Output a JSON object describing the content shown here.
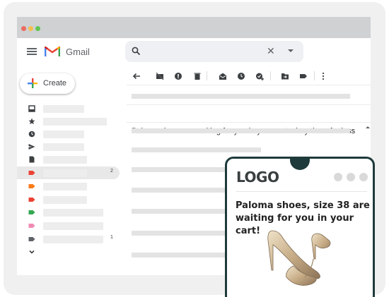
{
  "app": {
    "name": "Gmail"
  },
  "search": {
    "placeholder": ""
  },
  "compose": {
    "label": "Create"
  },
  "sidebar": {
    "items": [
      {
        "icon": "inbox-icon",
        "count": ""
      },
      {
        "icon": "star-icon",
        "count": ""
      },
      {
        "icon": "clock-icon",
        "count": ""
      },
      {
        "icon": "send-icon",
        "count": ""
      },
      {
        "icon": "document-icon",
        "count": ""
      },
      {
        "icon": "label-icon",
        "count": "2",
        "active": true,
        "color": "#ea4335"
      },
      {
        "icon": "label-icon",
        "count": "",
        "color": "#fa7b17"
      },
      {
        "icon": "label-icon",
        "count": "",
        "color": "#ea4335"
      },
      {
        "icon": "label-icon",
        "count": "",
        "color": "#34a853"
      },
      {
        "icon": "label-icon",
        "count": "",
        "color": "#f28bb3"
      },
      {
        "icon": "label-icon",
        "count": "1",
        "color": "#5f6368"
      },
      {
        "icon": "chevron-down-icon",
        "count": ""
      }
    ]
  },
  "toolbar": {
    "icons": [
      "back-arrow-icon",
      "archive-icon",
      "report-spam-icon",
      "delete-icon",
      "mark-unread-icon",
      "snooze-icon",
      "add-task-icon",
      "move-to-icon",
      "labels-icon",
      "more-icon"
    ]
  },
  "email": {
    "subject": "Paloma shoes are waiting for you in your cart – buy them for less"
  },
  "ad": {
    "logo": "LOGO",
    "title": "Paloma shoes, size 38 are waiting for you in your cart!"
  },
  "colors": {
    "phone_border": "#1e3a3a",
    "gmail_red": "#ea4335",
    "gmail_blue": "#4285f4",
    "gmail_yellow": "#fbbc04",
    "gmail_green": "#34a853",
    "window_dots": [
      "#ed6a5e",
      "#f5bf4f",
      "#61c554"
    ]
  }
}
